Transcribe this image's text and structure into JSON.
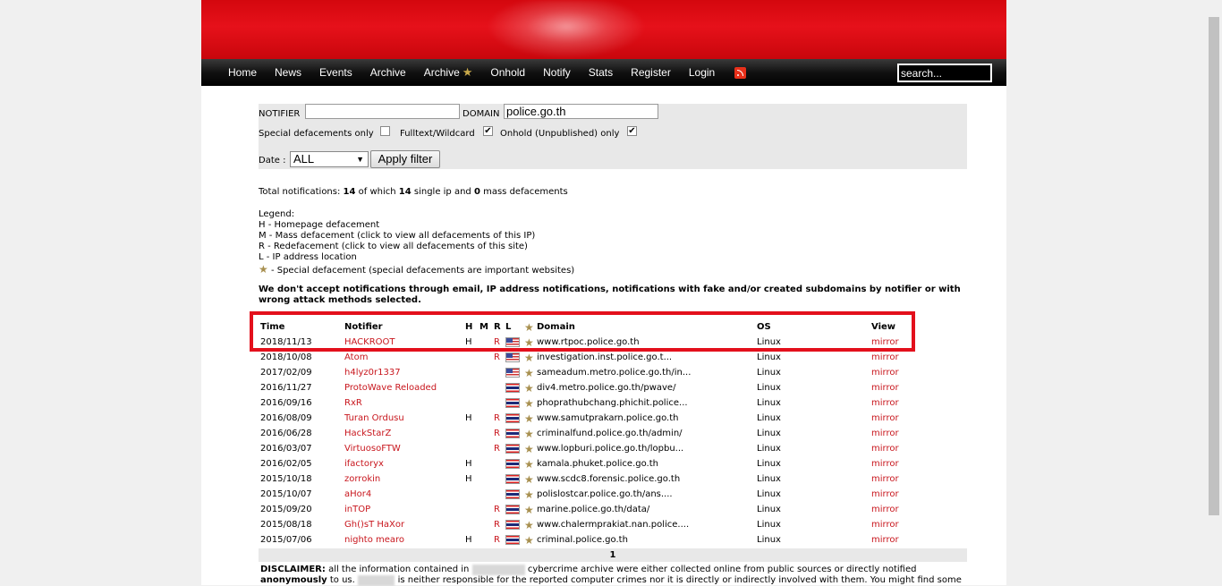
{
  "nav": {
    "items": [
      {
        "label": "Home"
      },
      {
        "label": "News"
      },
      {
        "label": "Events"
      },
      {
        "label": "Archive"
      },
      {
        "label": "Archive",
        "star": "★"
      },
      {
        "label": "Onhold"
      },
      {
        "label": "Notify"
      },
      {
        "label": "Stats"
      },
      {
        "label": "Register"
      },
      {
        "label": "Login"
      }
    ],
    "search_value": "search..."
  },
  "filter": {
    "notifier_label": "NOTIFIER",
    "notifier_value": "",
    "domain_label": "DOMAIN",
    "domain_value": "police.go.th",
    "special_label": "Special defacements only",
    "special_checked": false,
    "fulltext_label": "Fulltext/Wildcard",
    "fulltext_checked": true,
    "onhold_label": "Onhold (Unpublished) only",
    "onhold_checked": true,
    "date_label": "Date :",
    "date_value": "ALL",
    "apply_label": "Apply filter"
  },
  "summary": {
    "prefix": "Total notifications: ",
    "total": "14",
    "middle": " of which ",
    "single": "14",
    "middle2": " single ip and ",
    "mass": "0",
    "suffix": " mass defacements"
  },
  "legend": {
    "title": "Legend:",
    "lines": [
      "H - Homepage defacement",
      "M - Mass defacement (click to view all defacements of this IP)",
      "R - Redefacement (click to view all defacements of this site)",
      "L - IP address location"
    ],
    "special_line": "- Special defacement (special defacements are important websites)"
  },
  "warning": "We don't accept notifications through email, IP address notifications, notifications with fake and/or created subdomains by notifier or with wrong attack methods selected.",
  "table": {
    "headers": {
      "time": "Time",
      "notifier": "Notifier",
      "h": "H",
      "m": "M",
      "r": "R",
      "l": "L",
      "domain": "Domain",
      "os": "OS",
      "view": "View"
    },
    "rows": [
      {
        "time": "2018/11/13",
        "notifier": "HACKROOT",
        "h": "H",
        "r": "R",
        "flag": "us",
        "domain": "www.rtpoc.police.go.th",
        "os": "Linux",
        "view": "mirror"
      },
      {
        "time": "2018/10/08",
        "notifier": "Atom",
        "h": "",
        "r": "R",
        "flag": "us",
        "domain": "investigation.inst.police.go.t...",
        "os": "Linux",
        "view": "mirror"
      },
      {
        "time": "2017/02/09",
        "notifier": "h4lyz0r1337",
        "h": "",
        "r": "",
        "flag": "us",
        "domain": "sameadum.metro.police.go.th/in...",
        "os": "Linux",
        "view": "mirror"
      },
      {
        "time": "2016/11/27",
        "notifier": "ProtoWave Reloaded",
        "h": "",
        "r": "",
        "flag": "th",
        "domain": "div4.metro.police.go.th/pwave/",
        "os": "Linux",
        "view": "mirror"
      },
      {
        "time": "2016/09/16",
        "notifier": "RxR",
        "h": "",
        "r": "",
        "flag": "th",
        "domain": "phoprathubchang.phichit.police...",
        "os": "Linux",
        "view": "mirror"
      },
      {
        "time": "2016/08/09",
        "notifier": "Turan Ordusu",
        "h": "H",
        "r": "R",
        "flag": "th",
        "domain": "www.samutprakarn.police.go.th",
        "os": "Linux",
        "view": "mirror"
      },
      {
        "time": "2016/06/28",
        "notifier": "HackStarZ",
        "h": "",
        "r": "R",
        "flag": "th",
        "domain": "criminalfund.police.go.th/admin/",
        "os": "Linux",
        "view": "mirror"
      },
      {
        "time": "2016/03/07",
        "notifier": "VirtuosoFTW",
        "h": "",
        "r": "R",
        "flag": "th",
        "domain": "www.lopburi.police.go.th/lopbu...",
        "os": "Linux",
        "view": "mirror"
      },
      {
        "time": "2016/02/05",
        "notifier": "ifactoryx",
        "h": "H",
        "r": "",
        "flag": "th",
        "domain": "kamala.phuket.police.go.th",
        "os": "Linux",
        "view": "mirror"
      },
      {
        "time": "2015/10/18",
        "notifier": "zorrokin",
        "h": "H",
        "r": "",
        "flag": "th",
        "domain": "www.scdc8.forensic.police.go.th",
        "os": "Linux",
        "view": "mirror"
      },
      {
        "time": "2015/10/07",
        "notifier": "aHor4",
        "h": "",
        "r": "",
        "flag": "th",
        "domain": "polislostcar.police.go.th/ans....",
        "os": "Linux",
        "view": "mirror"
      },
      {
        "time": "2015/09/20",
        "notifier": "inTOP",
        "h": "",
        "r": "R",
        "flag": "th",
        "domain": "marine.police.go.th/data/",
        "os": "Linux",
        "view": "mirror"
      },
      {
        "time": "2015/08/18",
        "notifier": "Gh()sT HaXor",
        "h": "",
        "r": "R",
        "flag": "th",
        "domain": "www.chalermprakiat.nan.police....",
        "os": "Linux",
        "view": "mirror"
      },
      {
        "time": "2015/07/06",
        "notifier": "nighto mearo",
        "h": "H",
        "r": "R",
        "flag": "th",
        "domain": "criminal.police.go.th",
        "os": "Linux",
        "view": "mirror"
      }
    ]
  },
  "pager": {
    "current": "1"
  },
  "disclaimer": {
    "label": "DISCLAIMER:",
    "line1a": " all the information contained in ",
    "line1b": " cybercrime archive were either collected online from public sources or directly notified",
    "line2_bold": "anonymously",
    "line2a": " to us. ",
    "line2b": " is neither responsible for the reported computer crimes nor it is directly or indirectly involved with them. You might find some"
  },
  "colors": {
    "accent_red": "#c8161d",
    "banner_red": "#e6111a",
    "highlight_box": "#e3101c"
  }
}
